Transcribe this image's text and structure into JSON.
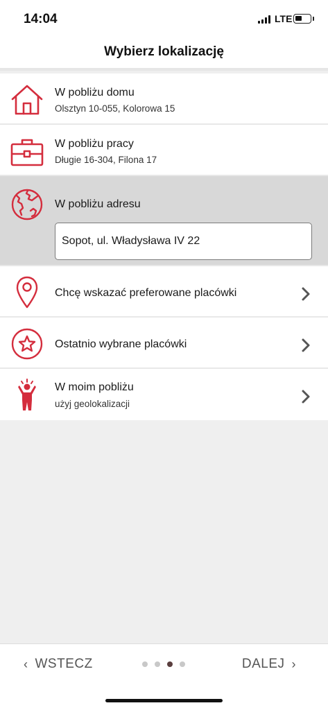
{
  "status_bar": {
    "time": "14:04",
    "network": "LTE"
  },
  "header": {
    "title": "Wybierz lokalizację"
  },
  "options": {
    "home": {
      "title": "W pobliżu domu",
      "subtitle": "Olsztyn 10-055, Kolorowa 15",
      "icon": "house-icon"
    },
    "work": {
      "title": "W pobliżu pracy",
      "subtitle": "Długie 16-304, Filona 17",
      "icon": "briefcase-icon"
    },
    "address": {
      "title": "W pobliżu adresu",
      "input_value": "Sopot, ul. Władysława IV 22",
      "icon": "globe-icon"
    },
    "preferred": {
      "title": "Chcę wskazać preferowane placówki",
      "icon": "map-pin-icon"
    },
    "recent": {
      "title": "Ostatnio wybrane placówki",
      "icon": "star-icon"
    },
    "nearby": {
      "title": "W moim pobliżu",
      "subtitle": "użyj geolokalizacji",
      "icon": "person-icon"
    }
  },
  "footer": {
    "back_label": "WSTECZ",
    "next_label": "DALEJ",
    "back_arrow": "‹",
    "next_arrow": "›",
    "pages_total": 4,
    "current_page": 3
  },
  "colors": {
    "accent": "#d42d3d",
    "selected_bg": "#d8d8d8",
    "background": "#efefef"
  }
}
